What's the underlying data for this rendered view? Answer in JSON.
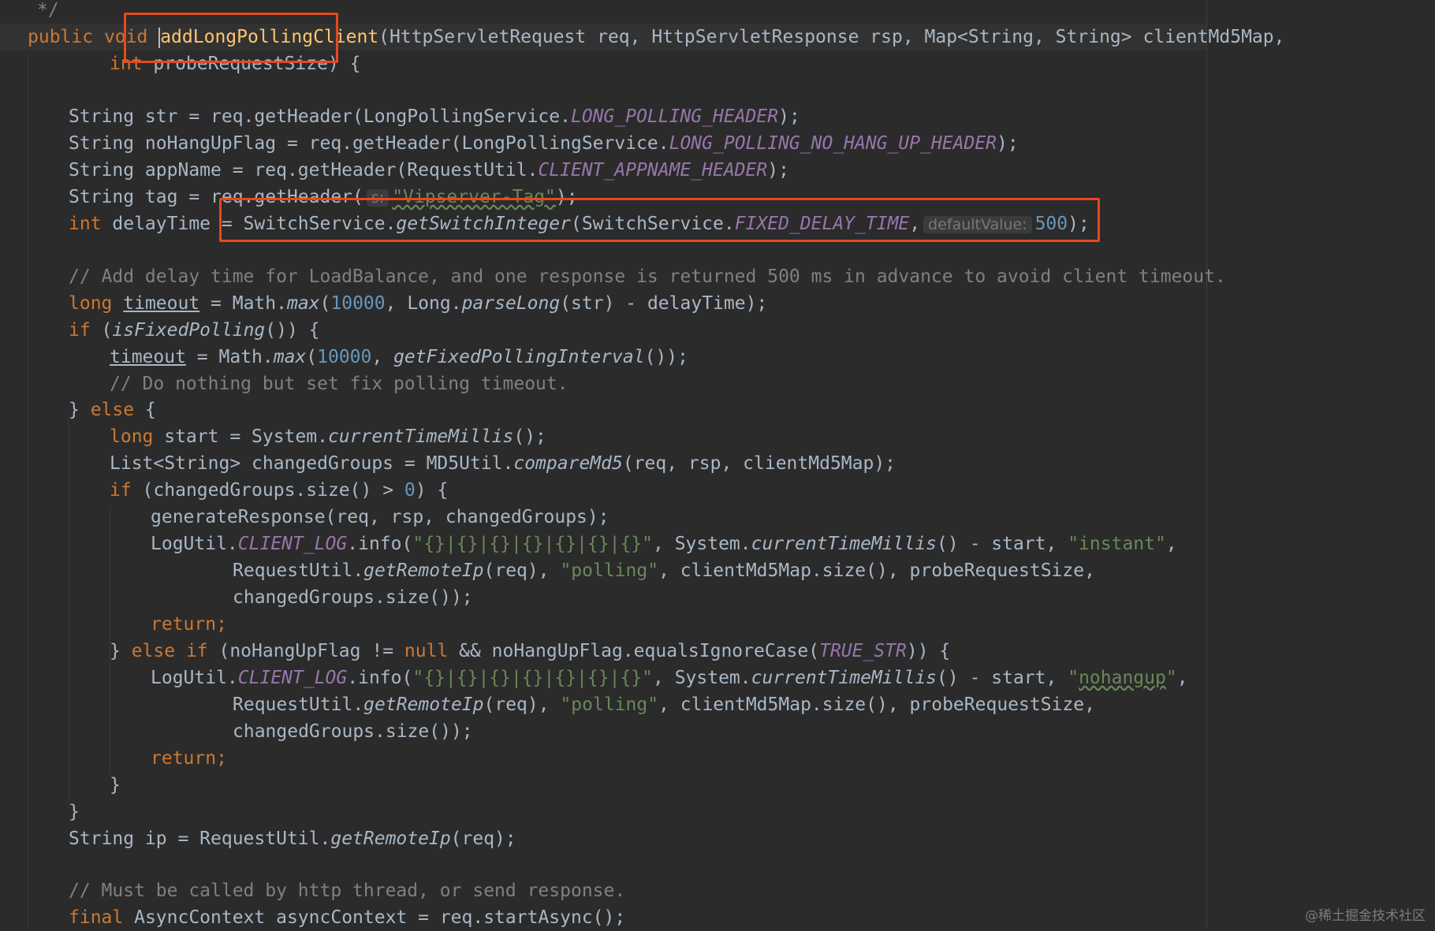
{
  "code": {
    "l0": {
      "cmt": "*/"
    },
    "l1": {
      "kw1": "public",
      "kw2": "void",
      "name": "addLongPollingClient",
      "rest": "(HttpServletRequest req, HttpServletResponse rsp, Map<String, String> clientMd5Map,"
    },
    "l2": {
      "kw": "int",
      "rest": " probeRequestSize) {"
    },
    "l4": {
      "a": "String str = req.getHeader(LongPollingService.",
      "c": "LONG_POLLING_HEADER",
      "b": ");"
    },
    "l5": {
      "a": "String noHangUpFlag = req.getHeader(LongPollingService.",
      "c": "LONG_POLLING_NO_HANG_UP_HEADER",
      "b": ");"
    },
    "l6": {
      "a": "String appName = req.getHeader(RequestUtil.",
      "c": "CLIENT_APPNAME_HEADER",
      "b": ");"
    },
    "l7": {
      "a": "String tag = req.getHeader(",
      "hint": "s:",
      "s": "\"Vipserver-Tag\"",
      "b": ");"
    },
    "l8": {
      "kw": "int",
      "a": " delayTime = SwitchService.",
      "m": "getSwitchInteger",
      "b": "(SwitchService.",
      "c": "FIXED_DELAY_TIME",
      "d": ",",
      "hint": "defaultValue:",
      "n": "500",
      "e": ");"
    },
    "l10": {
      "cmt": "// Add delay time for LoadBalance, and one response is returned 500 ms in advance to avoid client timeout."
    },
    "l11": {
      "kw": "long",
      "v": "timeout",
      "a": " = Math.",
      "m": "max",
      "b": "(",
      "n": "10000",
      "c": ", Long.",
      "m2": "parseLong",
      "d": "(str) - delayTime);"
    },
    "l12": {
      "kw": "if",
      "a": " (",
      "m": "isFixedPolling",
      "b": "()) {"
    },
    "l13": {
      "v": "timeout",
      "a": " = Math.",
      "m": "max",
      "b": "(",
      "n": "10000",
      "c": ", ",
      "m2": "getFixedPollingInterval",
      "d": "());"
    },
    "l14": {
      "cmt": "// Do nothing but set fix polling timeout."
    },
    "l15": {
      "a": "} ",
      "kw": "else",
      "b": " {"
    },
    "l16": {
      "kw": "long",
      "a": " start = System.",
      "m": "currentTimeMillis",
      "b": "();"
    },
    "l17": {
      "a": "List<String> changedGroups = MD5Util.",
      "m": "compareMd5",
      "b": "(req, rsp, clientMd5Map);"
    },
    "l18": {
      "kw": "if",
      "a": " (changedGroups.size() > ",
      "n": "0",
      "b": ") {"
    },
    "l19": {
      "a": "generateResponse(req, rsp, changedGroups);"
    },
    "l20": {
      "a": "LogUtil.",
      "c": "CLIENT_LOG",
      "b": ".info(",
      "s": "\"{}|{}|{}|{}|{}|{}|{}\"",
      "d": ", System.",
      "m": "currentTimeMillis",
      "e": "() - start, ",
      "s2": "\"instant\"",
      "f": ","
    },
    "l21": {
      "a": "RequestUtil.",
      "m": "getRemoteIp",
      "b": "(req), ",
      "s": "\"polling\"",
      "c": ", clientMd5Map.size(), probeRequestSize,"
    },
    "l22": {
      "a": "changedGroups.size());"
    },
    "l23": {
      "kw": "return",
      "a": ";"
    },
    "l24": {
      "a": "} ",
      "kw": "else if",
      "b": " (noHangUpFlag != ",
      "kw2": "null",
      "c": " && noHangUpFlag.equalsIgnoreCase(",
      "k": "TRUE_STR",
      "d": ")) {"
    },
    "l25": {
      "a": "LogUtil.",
      "c": "CLIENT_LOG",
      "b": ".info(",
      "s": "\"{}|{}|{}|{}|{}|{}|{}\"",
      "d": ", System.",
      "m": "currentTimeMillis",
      "e": "() - start, ",
      "s2q": "\"",
      "s2": "nohangup",
      "s2q2": "\"",
      "f": ","
    },
    "l26": {
      "a": "RequestUtil.",
      "m": "getRemoteIp",
      "b": "(req), ",
      "s": "\"polling\"",
      "c": ", clientMd5Map.size(), probeRequestSize,"
    },
    "l27": {
      "a": "changedGroups.size());"
    },
    "l28": {
      "kw": "return",
      "a": ";"
    },
    "l29": {
      "a": "}"
    },
    "l30": {
      "a": "}"
    },
    "l31": {
      "a": "String ip = RequestUtil.",
      "m": "getRemoteIp",
      "b": "(req);"
    },
    "l33": {
      "cmt": "// Must be called by http thread, or send response."
    },
    "l34": {
      "kw": "final",
      "a": " AsyncContext asyncContext = req.startAsync();"
    }
  },
  "annotation": {
    "color": "#e6491e"
  },
  "watermark": "@稀土掘金技术社区"
}
